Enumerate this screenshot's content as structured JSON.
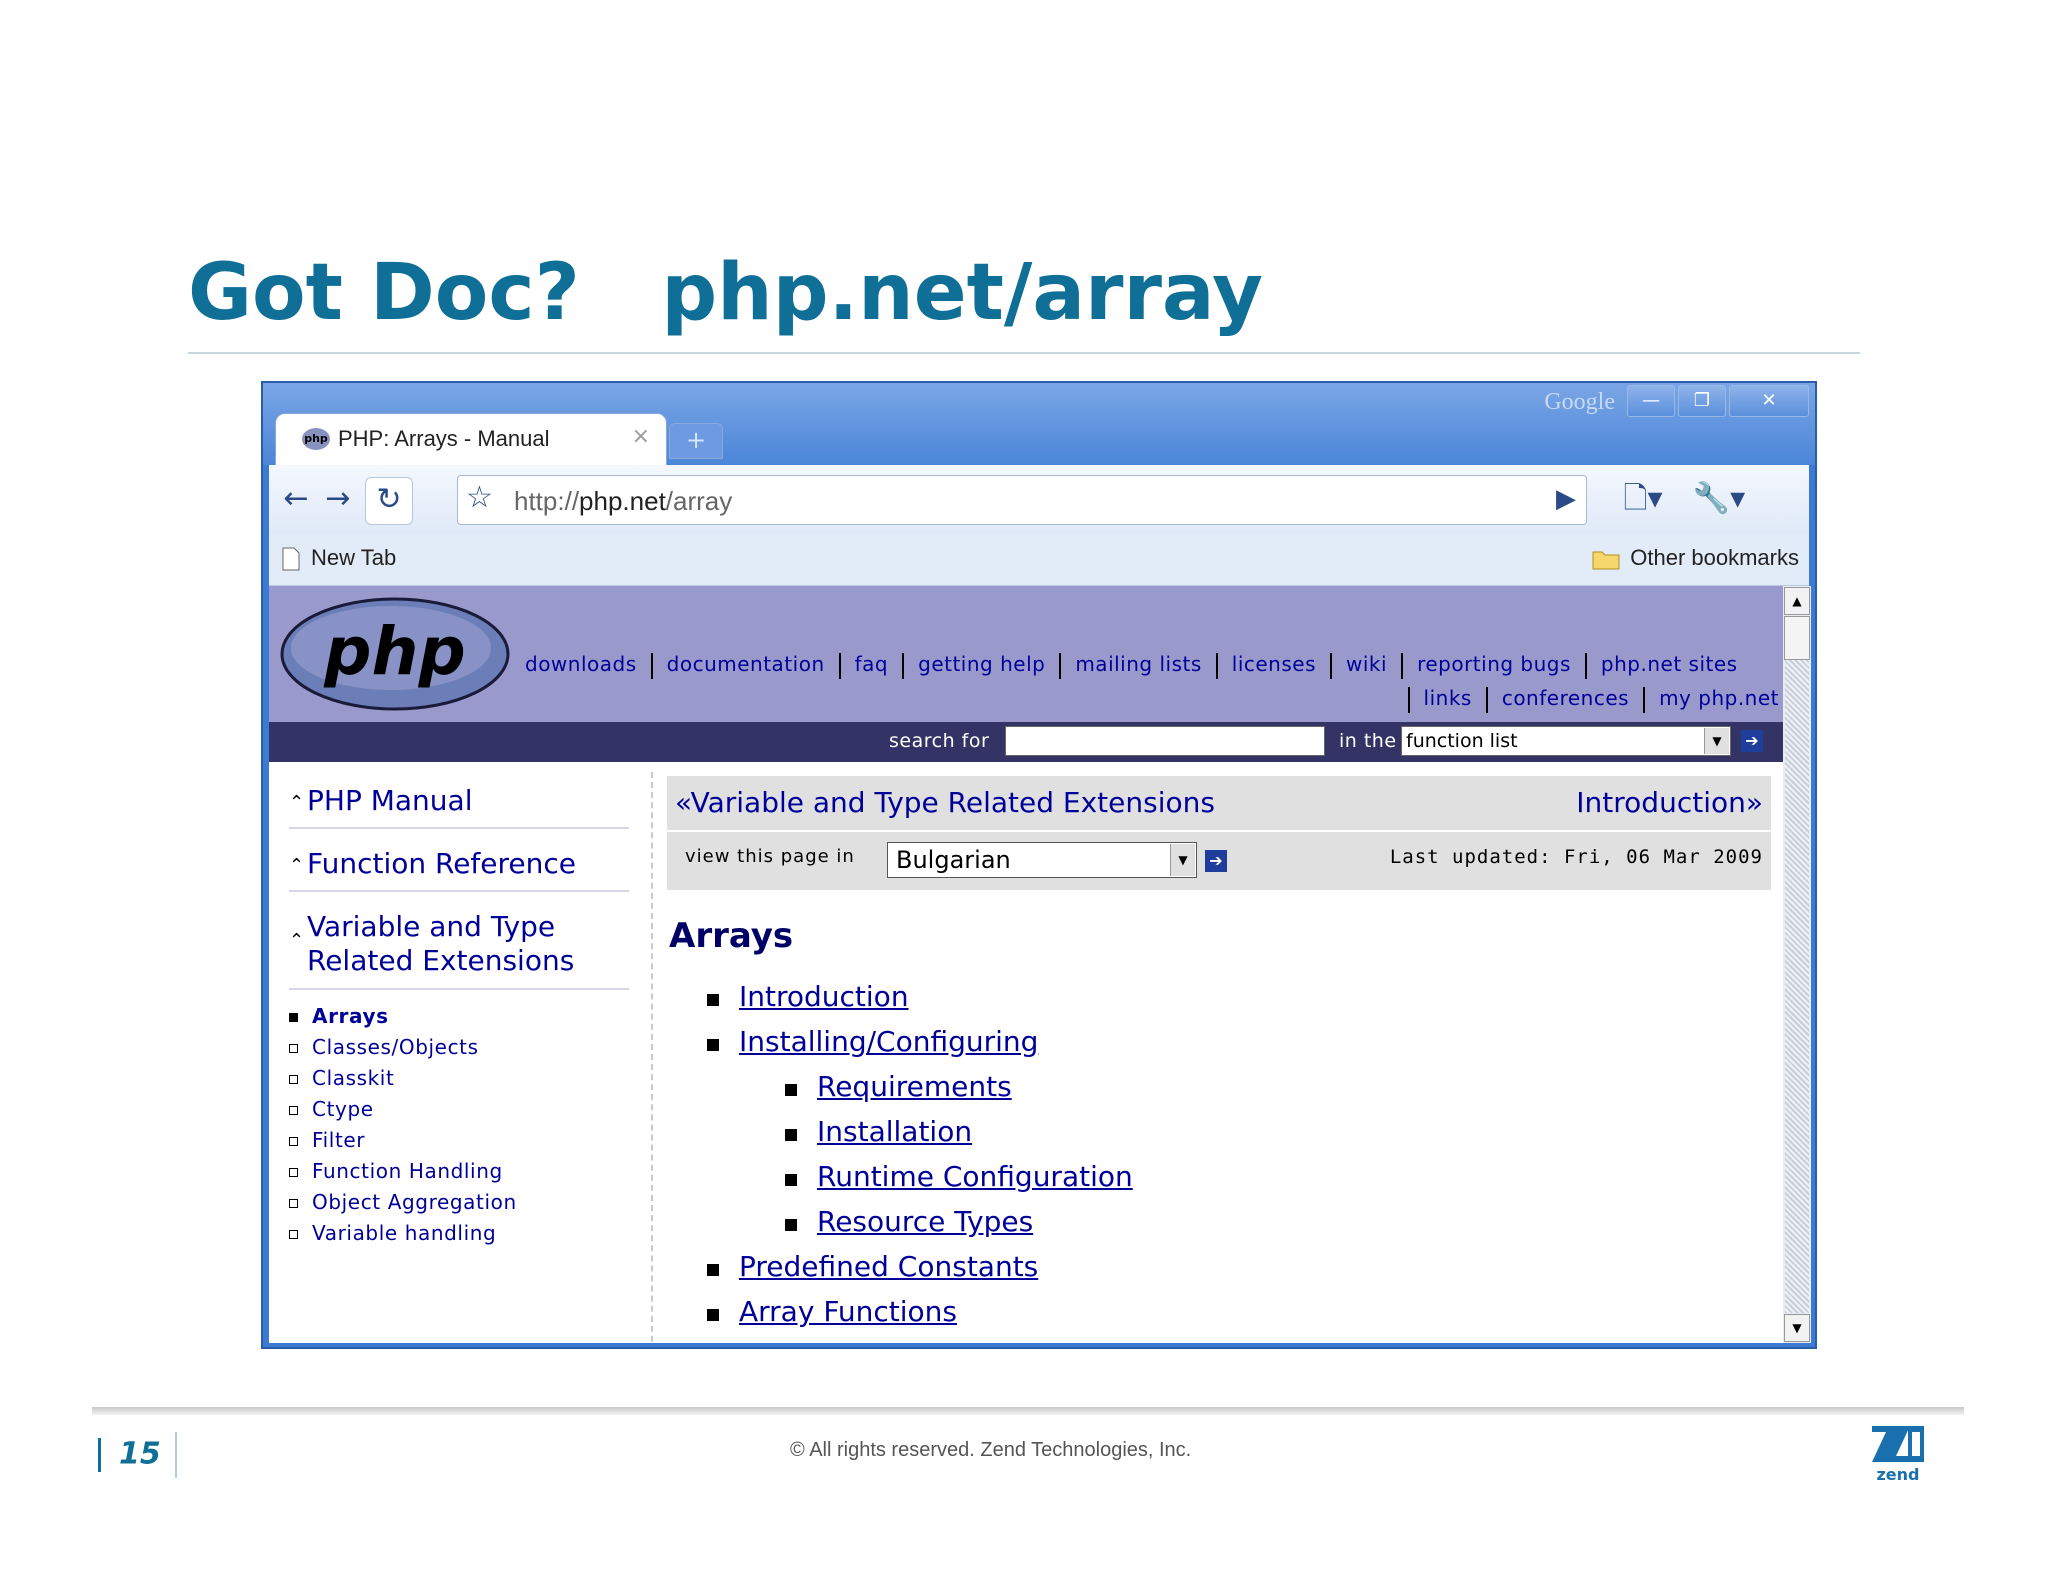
{
  "slide": {
    "title": "Got Doc?   php.net/array",
    "page_number": "15",
    "copyright": "© All rights reserved. Zend Technologies, Inc."
  },
  "browser": {
    "brand_label": "Google",
    "window_buttons": [
      "—",
      "❐",
      "✕"
    ],
    "tab": {
      "title": "PHP: Arrays - Manual",
      "favicon": "php",
      "close": "×",
      "new_tab": "+"
    },
    "url": {
      "scheme": "http://",
      "host": "php.net",
      "path": "/array"
    },
    "bookmarks": {
      "left": "New Tab",
      "right": "Other bookmarks"
    }
  },
  "php": {
    "logo_text": "php",
    "nav_row1": [
      "downloads",
      "documentation",
      "faq",
      "getting help",
      "mailing lists",
      "licenses",
      "wiki",
      "reporting bugs",
      "php.net sites"
    ],
    "nav_row2": [
      "links",
      "conferences",
      "my php.net"
    ],
    "search_label": "search for",
    "in_the_label": "in the",
    "search_scope": "function list"
  },
  "left_nav": {
    "manual": "PHP Manual",
    "function_reference": "Function Reference",
    "variable_type": "Variable and Type Related Extensions",
    "items": [
      "Arrays",
      "Classes/Objects",
      "Classkit",
      "Ctype",
      "Filter",
      "Function Handling",
      "Object Aggregation",
      "Variable handling"
    ]
  },
  "main": {
    "prev": "Variable and Type Related Extensions",
    "next": "Introduction",
    "view_label": "view this page in",
    "language": "Bulgarian",
    "last_updated": "Last updated: Fri, 06 Mar 2009",
    "heading": "Arrays",
    "toc": [
      {
        "label": "Introduction",
        "level": 1
      },
      {
        "label": "Installing/Configuring",
        "level": 1
      },
      {
        "label": "Requirements",
        "level": 2
      },
      {
        "label": "Installation",
        "level": 2
      },
      {
        "label": "Runtime Configuration",
        "level": 2
      },
      {
        "label": "Resource Types",
        "level": 2
      },
      {
        "label": "Predefined Constants",
        "level": 1
      },
      {
        "label": "Array Functions",
        "level": 1
      }
    ]
  },
  "colors": {
    "accent": "#0f6f97",
    "php_header": "#9999cc",
    "php_bar": "#333366",
    "link": "#000099"
  }
}
